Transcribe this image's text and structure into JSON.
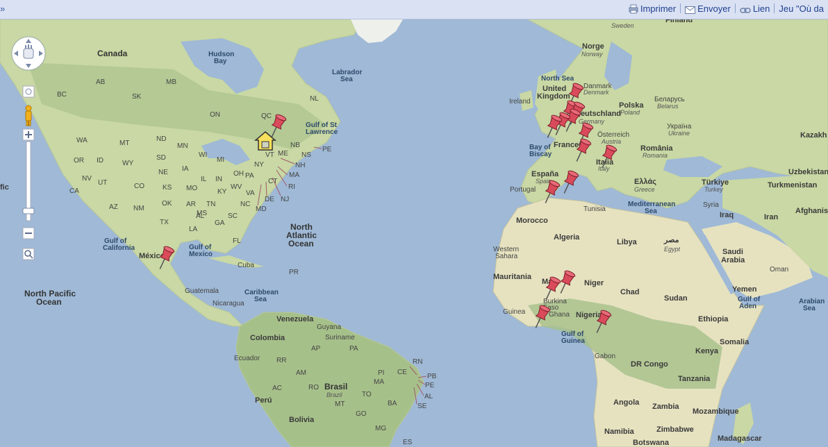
{
  "toolbar": {
    "expand_glyph": "»",
    "print_label": "Imprimer",
    "send_label": "Envoyer",
    "link_label": "Lien",
    "game_label": "Jeu \"Où da"
  },
  "icons": [
    "pan-hand-icon",
    "pegman-icon",
    "zoom-in-icon",
    "zoom-out-icon",
    "magnify-icon",
    "printer-icon",
    "envelope-icon",
    "chain-link-icon",
    "pushpin-marker-icon",
    "home-marker-icon"
  ],
  "colors": {
    "ocean": "#9fb9d6",
    "land": "#c9d8a4",
    "forest": "#a6c08a",
    "desert": "#e6e2c0",
    "pin": "#d94b5b",
    "border": "#a98fb4"
  },
  "map_labels": {
    "continents_countries": [
      {
        "name": "canada",
        "text": "Canada"
      },
      {
        "name": "hudson-bay",
        "text": "Hudson\nBay"
      },
      {
        "name": "labrador-sea",
        "text": "Labrador\nSea"
      },
      {
        "name": "gulf-st-lawrence",
        "text": "Gulf of St\nLawrence"
      },
      {
        "name": "north-atlantic",
        "text": "North\nAtlantic\nOcean"
      },
      {
        "name": "gulf-california",
        "text": "Gulf of\nCalifornia"
      },
      {
        "name": "gulf-mexico",
        "text": "Gulf of\nMexico"
      },
      {
        "name": "mexico",
        "text": "México"
      },
      {
        "name": "north-pacific",
        "text": "North Pacific\nOcean"
      },
      {
        "name": "cuba",
        "text": "Cuba"
      },
      {
        "name": "pr",
        "text": "PR"
      },
      {
        "name": "caribbean-sea",
        "text": "Caribbean\nSea"
      },
      {
        "name": "guatemala",
        "text": "Guatemala"
      },
      {
        "name": "nicaragua",
        "text": "Nicaragua"
      },
      {
        "name": "venezuela",
        "text": "Venezuela"
      },
      {
        "name": "guyana",
        "text": "Guyana"
      },
      {
        "name": "suriname",
        "text": "Suriname"
      },
      {
        "name": "colombia",
        "text": "Colombia"
      },
      {
        "name": "ecuador",
        "text": "Ecuador"
      },
      {
        "name": "peru",
        "text": "Perú"
      },
      {
        "name": "brasil",
        "text": "Brasil"
      },
      {
        "name": "brazil",
        "text": "Brazil"
      },
      {
        "name": "bolivia",
        "text": "Bolivia"
      },
      {
        "name": "sweden",
        "text": "Sweden"
      },
      {
        "name": "finland",
        "text": "Finland"
      },
      {
        "name": "norge",
        "text": "Norge"
      },
      {
        "name": "norway",
        "text": "Norway"
      },
      {
        "name": "north-sea",
        "text": "North Sea"
      },
      {
        "name": "danmark",
        "text": "Danmark"
      },
      {
        "name": "denmark",
        "text": "Denmark"
      },
      {
        "name": "united-kingdom",
        "text": "United\nKingdom"
      },
      {
        "name": "ireland",
        "text": "Ireland"
      },
      {
        "name": "deutschland",
        "text": "Deutschland"
      },
      {
        "name": "germany",
        "text": "Germany"
      },
      {
        "name": "polska",
        "text": "Polska"
      },
      {
        "name": "poland",
        "text": "Poland"
      },
      {
        "name": "belarus-native",
        "text": "Беларусь"
      },
      {
        "name": "belarus",
        "text": "Belarus"
      },
      {
        "name": "ukraine-native",
        "text": "Україна"
      },
      {
        "name": "ukraine",
        "text": "Ukraine"
      },
      {
        "name": "osterreich",
        "text": "Österreich"
      },
      {
        "name": "austria",
        "text": "Austria"
      },
      {
        "name": "romania",
        "text": "România"
      },
      {
        "name": "romania-en",
        "text": "Romania"
      },
      {
        "name": "france",
        "text": "France"
      },
      {
        "name": "bay-biscay",
        "text": "Bay of\nBiscay"
      },
      {
        "name": "italia",
        "text": "Italia"
      },
      {
        "name": "italy",
        "text": "Italy"
      },
      {
        "name": "espana",
        "text": "España"
      },
      {
        "name": "spain",
        "text": "Spain"
      },
      {
        "name": "portugal",
        "text": "Portugal"
      },
      {
        "name": "ellas",
        "text": "Ελλάς"
      },
      {
        "name": "greece",
        "text": "Greece"
      },
      {
        "name": "turkiye",
        "text": "Türkiye"
      },
      {
        "name": "turkey",
        "text": "Turkey"
      },
      {
        "name": "med-sea",
        "text": "Mediterranean\nSea"
      },
      {
        "name": "tunisia",
        "text": "Tunisia"
      },
      {
        "name": "morocco",
        "text": "Morocco"
      },
      {
        "name": "algeria",
        "text": "Algeria"
      },
      {
        "name": "libya",
        "text": "Libya"
      },
      {
        "name": "misr",
        "text": "مصر"
      },
      {
        "name": "egypt",
        "text": "Egypt"
      },
      {
        "name": "western-sahara",
        "text": "Western\nSahara"
      },
      {
        "name": "mauritania",
        "text": "Mauritania"
      },
      {
        "name": "mali",
        "text": "Mali"
      },
      {
        "name": "niger",
        "text": "Niger"
      },
      {
        "name": "chad",
        "text": "Chad"
      },
      {
        "name": "sudan",
        "text": "Sudan"
      },
      {
        "name": "burkina",
        "text": "Burkina\nFaso"
      },
      {
        "name": "guinea",
        "text": "Guinea"
      },
      {
        "name": "ghana",
        "text": "Ghana"
      },
      {
        "name": "nigeria",
        "text": "Nigeria"
      },
      {
        "name": "gulf-guinea",
        "text": "Gulf of\nGuinea"
      },
      {
        "name": "gabon",
        "text": "Gabon"
      },
      {
        "name": "dr-congo",
        "text": "DR Congo"
      },
      {
        "name": "kenya",
        "text": "Kenya"
      },
      {
        "name": "tanzania",
        "text": "Tanzania"
      },
      {
        "name": "angola",
        "text": "Angola"
      },
      {
        "name": "zambia",
        "text": "Zambia"
      },
      {
        "name": "mozambique",
        "text": "Mozambique"
      },
      {
        "name": "zimbabwe",
        "text": "Zimbabwe"
      },
      {
        "name": "namibia",
        "text": "Namibia"
      },
      {
        "name": "botswana",
        "text": "Botswana"
      },
      {
        "name": "madagascar",
        "text": "Madagascar"
      },
      {
        "name": "ethiopia",
        "text": "Ethiopia"
      },
      {
        "name": "somalia",
        "text": "Somalia"
      },
      {
        "name": "yemen",
        "text": "Yemen"
      },
      {
        "name": "gulf-aden",
        "text": "Gulf of\nAden"
      },
      {
        "name": "arabian-sea",
        "text": "Arabian\nSea"
      },
      {
        "name": "oman",
        "text": "Oman"
      },
      {
        "name": "saudi",
        "text": "Saudi\nArabia"
      },
      {
        "name": "syria",
        "text": "Syria"
      },
      {
        "name": "iraq",
        "text": "Iraq"
      },
      {
        "name": "iran",
        "text": "Iran"
      },
      {
        "name": "afghanistan",
        "text": "Afghanis"
      },
      {
        "name": "turkmenistan",
        "text": "Turkmenistan"
      },
      {
        "name": "uzbekistan",
        "text": "Uzbekistan"
      },
      {
        "name": "kazakh",
        "text": "Kazakh"
      },
      {
        "name": "fic",
        "text": "fic"
      }
    ],
    "states": [
      "AB",
      "BC",
      "SK",
      "MB",
      "ON",
      "QC",
      "NL",
      "NB",
      "NS",
      "PE",
      "VT",
      "ME",
      "NH",
      "MA",
      "RI",
      "CT",
      "NJ",
      "DE",
      "MD",
      "NY",
      "PA",
      "VA",
      "WV",
      "OH",
      "KY",
      "NC",
      "SC",
      "TN",
      "GA",
      "AL",
      "MS",
      "LA",
      "AR",
      "MO",
      "IL",
      "IN",
      "MI",
      "WI",
      "IA",
      "MN",
      "ND",
      "SD",
      "NE",
      "KS",
      "OK",
      "TX",
      "NM",
      "CO",
      "WY",
      "MT",
      "ID",
      "WA",
      "OR",
      "NV",
      "UT",
      "AZ",
      "CA",
      "FL",
      "RN",
      "PB",
      "PE2",
      "AL2",
      "SE",
      "CE",
      "PI",
      "MA2",
      "PA2",
      "AM",
      "AC",
      "RO",
      "MT2",
      "TO",
      "BA",
      "GO",
      "MG",
      "ES",
      "AP",
      "RR"
    ]
  }
}
